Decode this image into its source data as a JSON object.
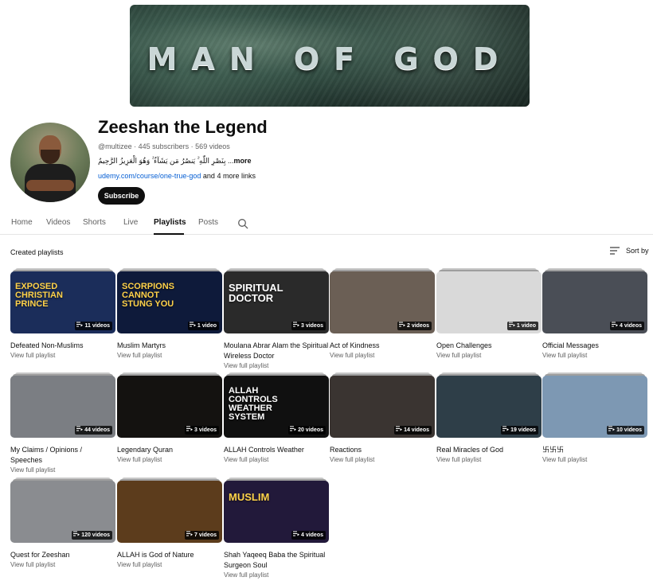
{
  "banner": {
    "title": "MAN OF GOD"
  },
  "channel": {
    "name": "Zeeshan the Legend",
    "meta": "@multizee · 445 subscribers · 569 videos",
    "description": "بِنَصْرِ اللّٰهِ ۚ يَنصُرُ مَن يَشَآءُ ۚ وَهُوَ الْعَزِيزُ الرَّحِيمُ ...",
    "more_label": "more",
    "link": "udemy.com/course/one-true-god",
    "more_links": "and 4 more links",
    "subscribe_label": "Subscribe"
  },
  "tabs": [
    {
      "label": "Home"
    },
    {
      "label": "Videos"
    },
    {
      "label": "Shorts"
    },
    {
      "label": "Live"
    },
    {
      "label": "Playlists"
    },
    {
      "label": "Posts"
    }
  ],
  "section": {
    "title": "Created playlists",
    "sort_label": "Sort by"
  },
  "view_full_label": "View full playlist",
  "playlists": [
    {
      "title": "Defeated Non-Muslims",
      "count": "11 videos",
      "bg": "#1b2d5a",
      "caption": "EXPOSED CHRISTIAN PRINCE",
      "cap_color": "#ffd24a"
    },
    {
      "title": "Muslim Martyrs",
      "count": "1 video",
      "bg": "#0e1a3a",
      "caption": "SCORPIONS CANNOT STUNG YOU",
      "cap_color": "#ffd24a"
    },
    {
      "title": "Moulana Abrar Alam the Spiritual Wireless Doctor",
      "count": "3 videos",
      "bg": "#2a2a2a",
      "caption": "SPIRITUAL DOCTOR",
      "cap_color": "#ffffff"
    },
    {
      "title": "Act of Kindness",
      "count": "2 videos",
      "bg": "#6b5f55",
      "caption": "",
      "cap_color": "#ffffff"
    },
    {
      "title": "Open Challenges",
      "count": "1 video",
      "bg": "#d9d9d9",
      "caption": "",
      "cap_color": "#111111"
    },
    {
      "title": "Official Messages",
      "count": "4 videos",
      "bg": "#4a4e56",
      "caption": "",
      "cap_color": "#ffffff"
    },
    {
      "title": "My Claims / Opinions / Speeches",
      "count": "44 videos",
      "bg": "#7b7e83",
      "caption": "",
      "cap_color": "#ffffff"
    },
    {
      "title": "Legendary Quran",
      "count": "3 videos",
      "bg": "#141210",
      "caption": "",
      "cap_color": "#ffffff"
    },
    {
      "title": "ALLAH Controls Weather",
      "count": "20 videos",
      "bg": "#101010",
      "caption": "ALLAH CONTROLS WEATHER SYSTEM",
      "cap_color": "#ffffff"
    },
    {
      "title": "Reactions",
      "count": "14 videos",
      "bg": "#3a3431",
      "caption": "",
      "cap_color": "#ffffff"
    },
    {
      "title": "Real Miracles of God",
      "count": "19 videos",
      "bg": "#2e3e48",
      "caption": "",
      "cap_color": "#ffffff"
    },
    {
      "title": "卐卐卐",
      "count": "10 videos",
      "bg": "#7d98b3",
      "caption": "",
      "cap_color": "#ffffff"
    },
    {
      "title": "Quest for Zeeshan",
      "count": "120 videos",
      "bg": "#8a8c90",
      "caption": "",
      "cap_color": "#ffffff"
    },
    {
      "title": "ALLAH is God of Nature",
      "count": "7 videos",
      "bg": "#5c3c1c",
      "caption": "",
      "cap_color": "#ffffff"
    },
    {
      "title": "Shah Yaqeeq Baba the Spiritual Surgeon Soul",
      "count": "4 videos",
      "bg": "#22193a",
      "caption": "MUSLIM",
      "cap_color": "#ffd24a"
    }
  ],
  "colors": {
    "link": "#065fd4",
    "subscribe_bg": "#0f0f0f",
    "meta_text": "#606060"
  }
}
